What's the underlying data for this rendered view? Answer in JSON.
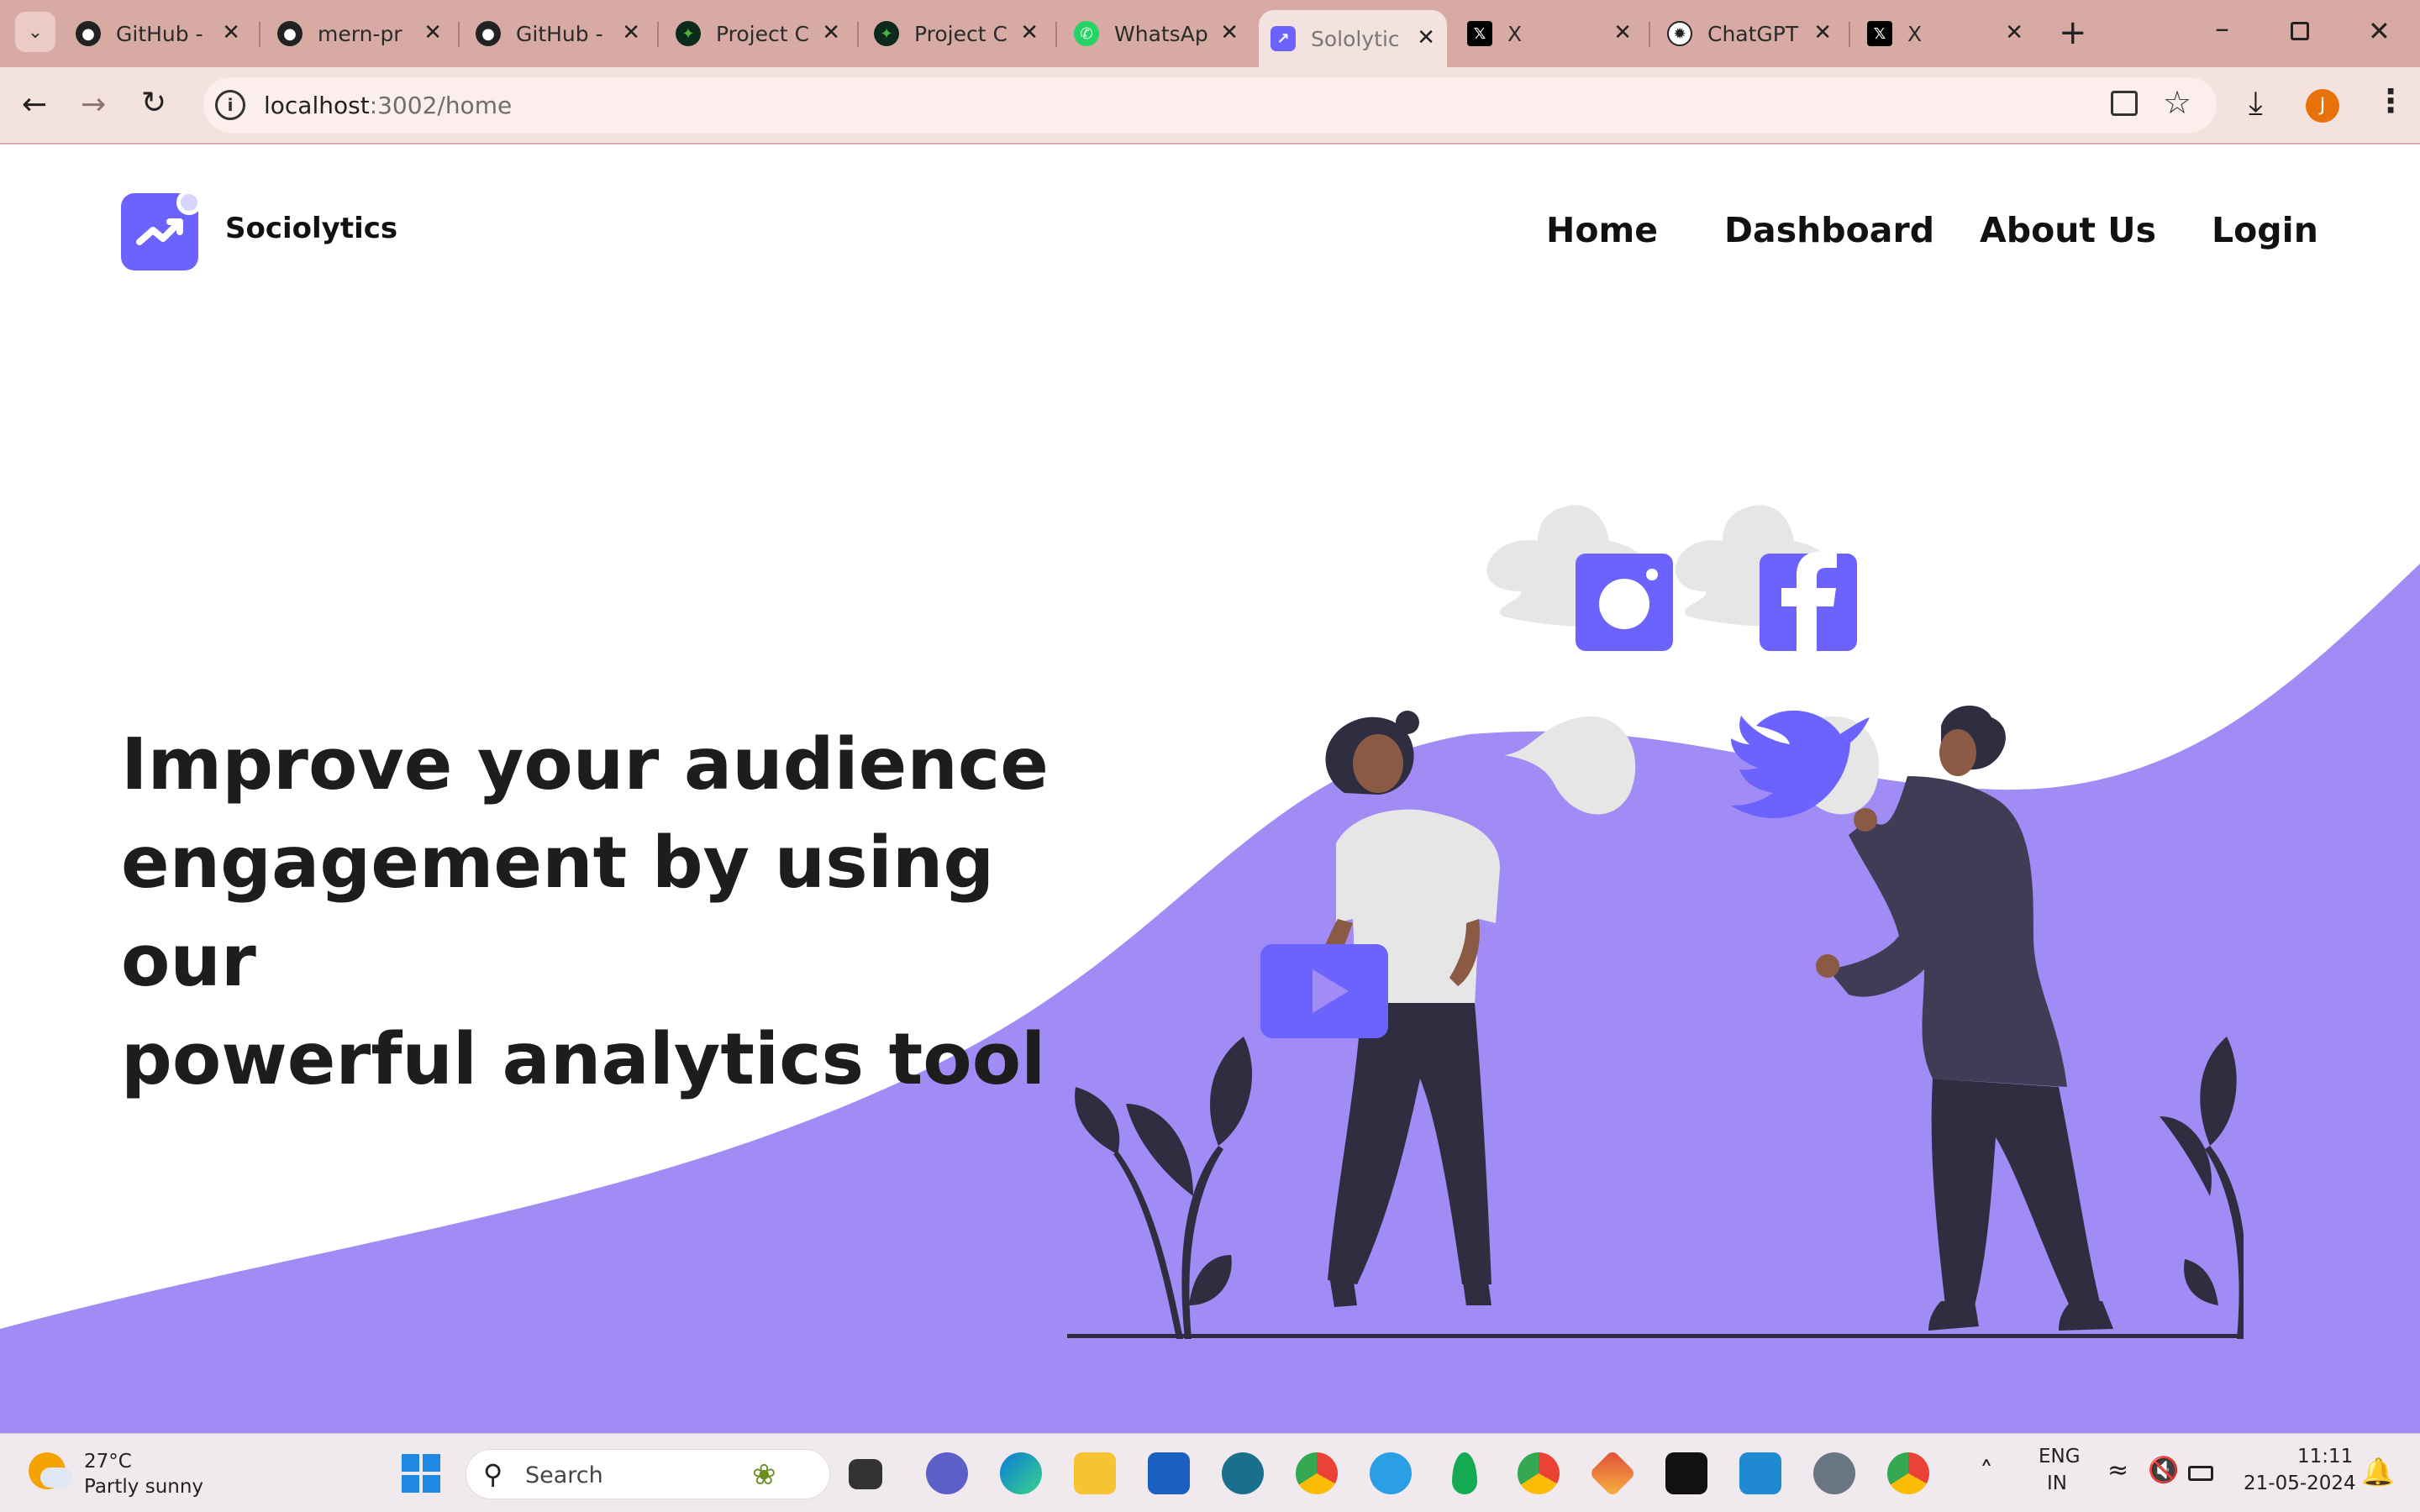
{
  "browser": {
    "tabs": [
      {
        "title": "GitHub -",
        "icon": "github-icon"
      },
      {
        "title": "mern-pr",
        "icon": "github-icon"
      },
      {
        "title": "GitHub -",
        "icon": "github-icon"
      },
      {
        "title": "Project C",
        "icon": "mongodb-leaf-icon"
      },
      {
        "title": "Project C",
        "icon": "mongodb-leaf-icon"
      },
      {
        "title": "WhatsAp",
        "icon": "whatsapp-icon"
      },
      {
        "title": "Sololytic",
        "icon": "sociolytics-icon"
      },
      {
        "title": "X",
        "icon": "x-icon"
      },
      {
        "title": "ChatGPT",
        "icon": "chatgpt-icon"
      },
      {
        "title": "X",
        "icon": "x-icon"
      }
    ],
    "url_host": "localhost",
    "url_path": ":3002/home",
    "profile_initial": "J"
  },
  "site": {
    "brand": "Sociolytics",
    "nav": [
      "Home",
      "Dashboard",
      "About Us",
      "Login"
    ],
    "headline": [
      "Improve your audience",
      "engagement by using our",
      "powerful analytics tool"
    ],
    "colors": {
      "accent": "#6c63ff",
      "wave": "#a18bf4",
      "dark": "#2f2e41"
    }
  },
  "taskbar": {
    "weather_temp": "27°C",
    "weather_desc": "Partly sunny",
    "search_placeholder": "Search",
    "lang_top": "ENG",
    "lang_bottom": "IN",
    "time": "11:11",
    "date": "21-05-2024"
  }
}
